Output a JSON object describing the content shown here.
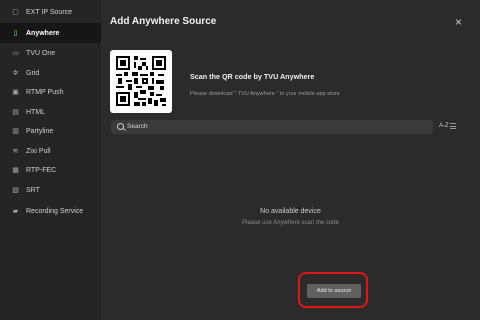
{
  "sidebar": {
    "items": [
      {
        "label": "EXT IP Source",
        "icon": "ext-ip-icon",
        "glyph": "▢"
      },
      {
        "label": "Anywhere",
        "icon": "anywhere-icon",
        "glyph": "▯"
      },
      {
        "label": "TVU One",
        "icon": "tvu-one-icon",
        "glyph": "▭"
      },
      {
        "label": "Grid",
        "icon": "grid-icon",
        "glyph": "✲"
      },
      {
        "label": "RTMP Push",
        "icon": "rtmp-icon",
        "glyph": "▣"
      },
      {
        "label": "HTML",
        "icon": "html-icon",
        "glyph": "▤"
      },
      {
        "label": "Partyline",
        "icon": "partyline-icon",
        "glyph": "▥"
      },
      {
        "label": "Zixi Pull",
        "icon": "zixi-icon",
        "glyph": "≋"
      },
      {
        "label": "RTP-FEC",
        "icon": "rtp-fec-icon",
        "glyph": "▦"
      },
      {
        "label": "SRT",
        "icon": "srt-icon",
        "glyph": "▧"
      },
      {
        "label": "Recording Service",
        "icon": "folder-icon",
        "glyph": "▰"
      }
    ],
    "active_index": 1
  },
  "modal": {
    "title": "Add Anywhere Source",
    "close_glyph": "×",
    "scan_title": "Scan the QR code by TVU Anywhere",
    "scan_subtitle": "Please download \" TVU Anywhere \" in your mobile app store",
    "search_placeholder": "Search",
    "sort_label": "A-Z",
    "empty_title": "No available device",
    "empty_subtitle": "Please use Anywhere scan the code",
    "add_button": "Add to source"
  },
  "colors": {
    "accent_green": "#3fb34f",
    "highlight_red": "#e01616"
  }
}
